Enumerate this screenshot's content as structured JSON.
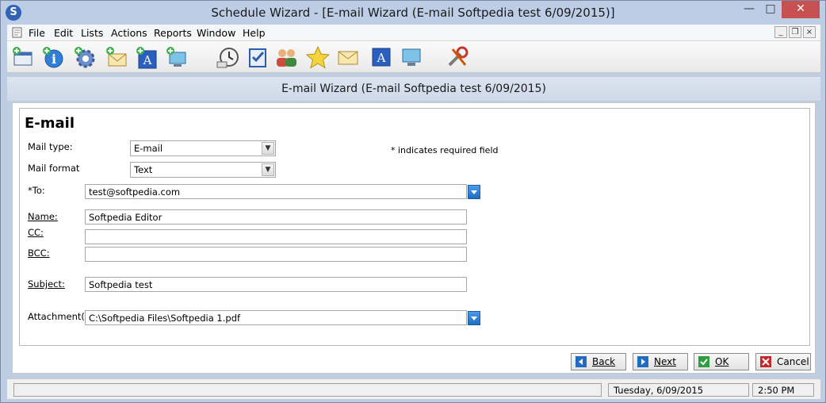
{
  "window": {
    "title": "Schedule Wizard - [E-mail Wizard  (E-mail Softpedia test  6/09/2015)]",
    "app_icon_glyph": "S",
    "controls": {
      "minimize": "—",
      "maximize": "□",
      "close": "✕"
    }
  },
  "menu": {
    "items": [
      "File",
      "Edit",
      "Lists",
      "Actions",
      "Reports",
      "Window",
      "Help"
    ],
    "mdi_controls": {
      "minimize": "_",
      "restore": "❐",
      "close": "×"
    }
  },
  "toolbar": {
    "icons": [
      "new-schedule-icon",
      "info-icon",
      "settings-gear-icon",
      "add-email-icon",
      "add-document-icon",
      "add-screen-icon",
      "clock-icon",
      "checklist-icon",
      "users-icon",
      "star-icon",
      "email-icon",
      "document-icon",
      "monitor-icon",
      "tools-icon"
    ]
  },
  "wizard": {
    "header": "E-mail Wizard  (E-mail Softpedia test  6/09/2015)",
    "heading": "E-mail",
    "required_note": "* indicates required field",
    "fields": {
      "mail_type": {
        "label": "Mail type:",
        "value": "E-mail"
      },
      "mail_format": {
        "label": "Mail format",
        "value": "Text"
      },
      "to": {
        "label": "*To:",
        "value": "test@softpedia.com"
      },
      "name": {
        "label": "Name:",
        "value": "Softpedia Editor"
      },
      "cc": {
        "label": "CC:",
        "value": ""
      },
      "bcc": {
        "label": "BCC:",
        "value": ""
      },
      "subject": {
        "label": "Subject:",
        "value": "Softpedia test"
      },
      "attachments": {
        "label": "Attachment(s):",
        "value": "C:\\Softpedia Files\\Softpedia 1.pdf"
      }
    },
    "buttons": {
      "back": "Back",
      "next": "Next",
      "ok": "OK",
      "cancel": "Cancel"
    }
  },
  "status": {
    "message": "",
    "date": "Tuesday,  6/09/2015",
    "time": "2:50 PM"
  },
  "colors": {
    "accent_blue": "#1f6cc3",
    "ok_green": "#2e9e3e",
    "cancel_red": "#c62828"
  }
}
